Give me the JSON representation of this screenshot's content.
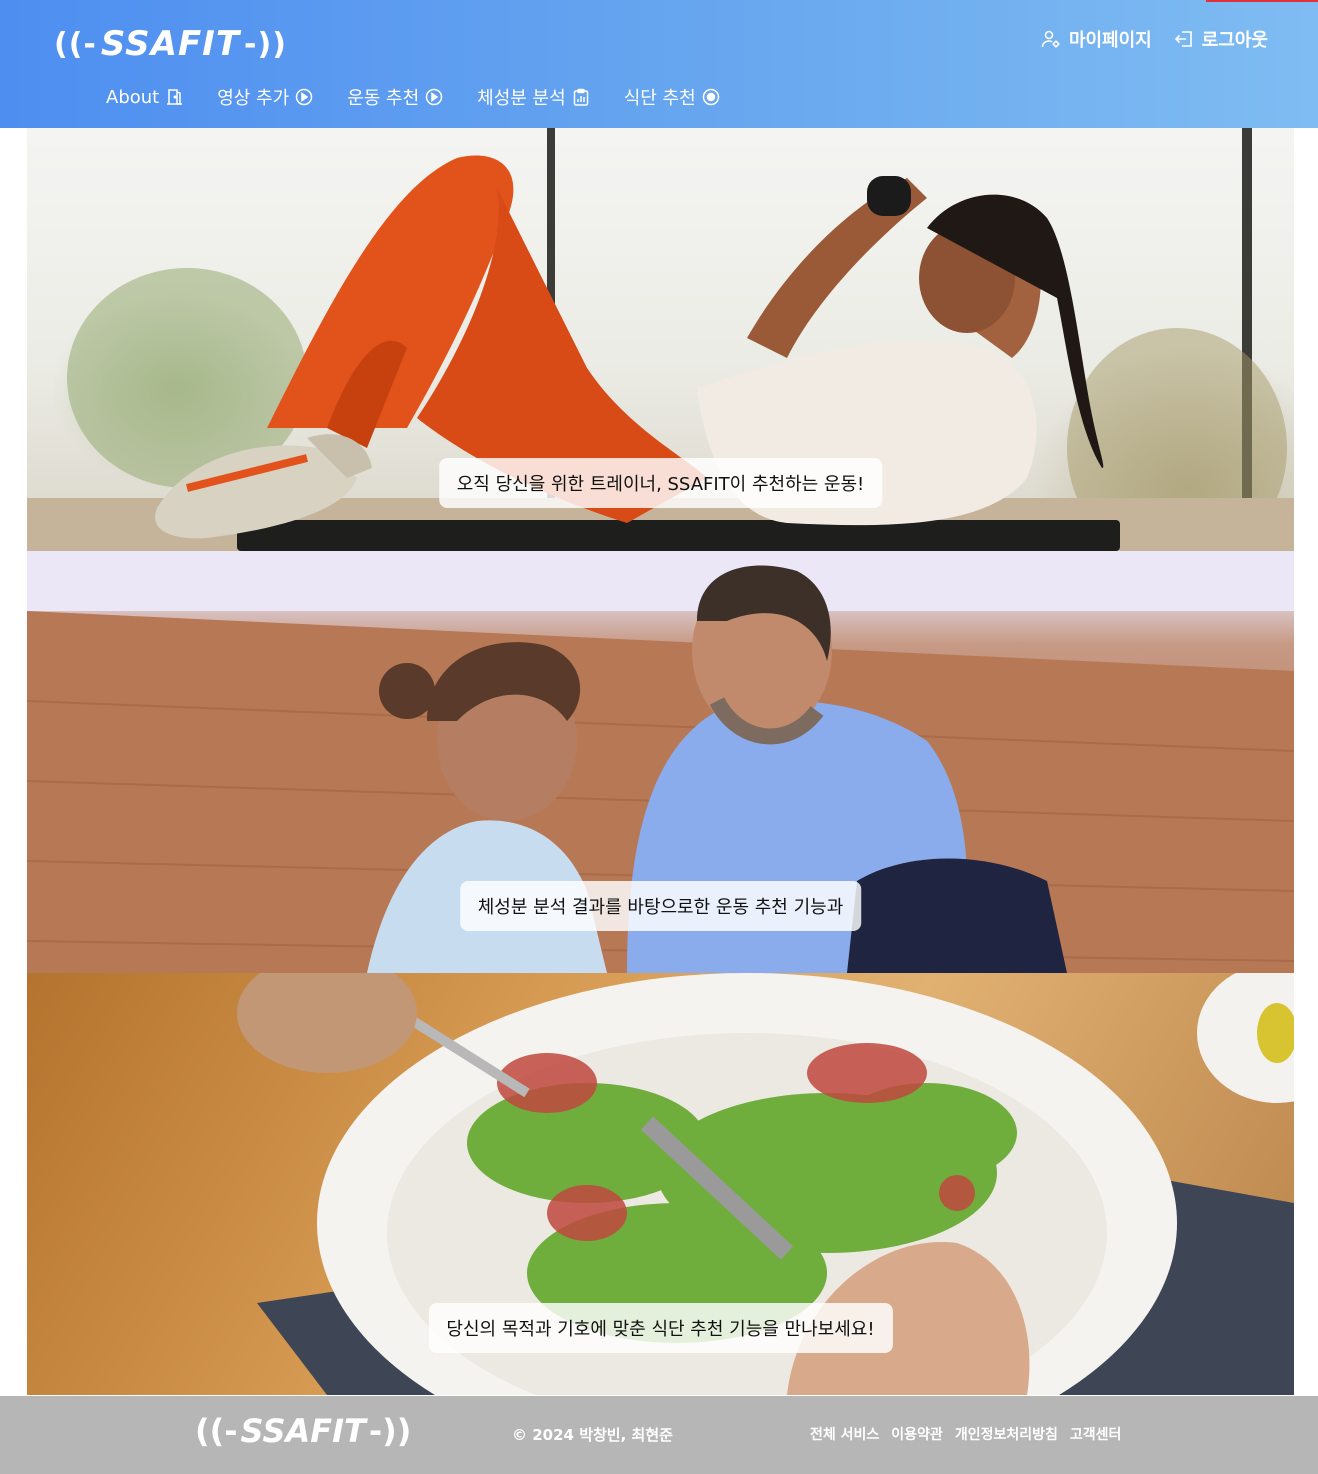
{
  "header": {
    "logo_left": "((-",
    "logo_text": "SSAFIT",
    "logo_right": "-))",
    "user_menu": {
      "mypage_label": "마이페이지",
      "mypage_icon": "user-gear-icon",
      "logout_label": "로그아웃",
      "logout_icon": "logout-icon"
    },
    "nav": [
      {
        "label": "About",
        "icon": "door-icon"
      },
      {
        "label": "영상 추가",
        "icon": "play-circle-icon"
      },
      {
        "label": "운동 추천",
        "icon": "play-circle-icon"
      },
      {
        "label": "체성분 분석",
        "icon": "clipboard-chart-icon"
      },
      {
        "label": "식단 추천",
        "icon": "meal-icon"
      }
    ],
    "colors": {
      "gradient_start": "#4e8ef0",
      "gradient_end": "#7fbcf3"
    }
  },
  "hero": {
    "slides": [
      {
        "caption": "오직 당신을 위한 트레이너, SSAFIT이 추천하는 운동!",
        "image": "woman-doing-crunches-photo"
      },
      {
        "caption": "체성분 분석 결과를 바탕으로한 운동 추천 기능과",
        "image": "couple-laughing-on-floor-photo"
      },
      {
        "caption": "당신의 목적과 기호에 맞춘 식단 추천 기능을 만나보세요!",
        "image": "salad-plate-photo"
      }
    ]
  },
  "footer": {
    "logo_left": "((-",
    "logo_text": "SSAFIT",
    "logo_right": "-))",
    "copyright": "© 2024 박창빈, 최현준",
    "links": [
      "전체 서비스",
      "이용약관",
      "개인정보처리방침",
      "고객센터"
    ],
    "background": "#b6b6b6"
  }
}
